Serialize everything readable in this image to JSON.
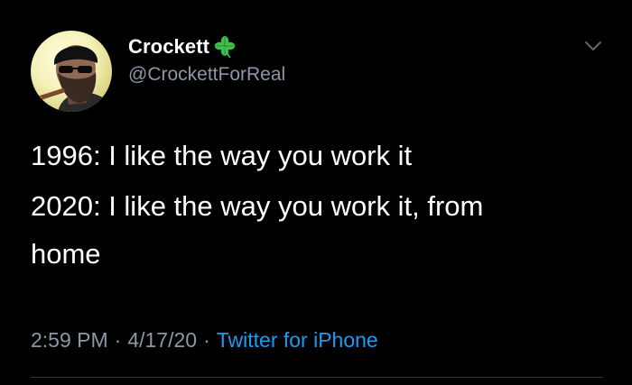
{
  "author": {
    "display_name": "Crockett",
    "badge_icon": "four-leaf-clover-icon",
    "handle": "@CrockettForReal"
  },
  "tweet": {
    "lines": [
      "1996: I like the way you work it",
      "2020: I like the way you work it, from",
      "home"
    ],
    "time": "2:59 PM",
    "separator": "·",
    "date": "4/17/20",
    "source": "Twitter for iPhone"
  },
  "colors": {
    "background": "#000000",
    "text": "#ffffff",
    "secondary": "#8b98a5",
    "link": "#1d9bf0",
    "clover": "#3fbf4a"
  },
  "icons": {
    "menu": "chevron-down-icon"
  }
}
